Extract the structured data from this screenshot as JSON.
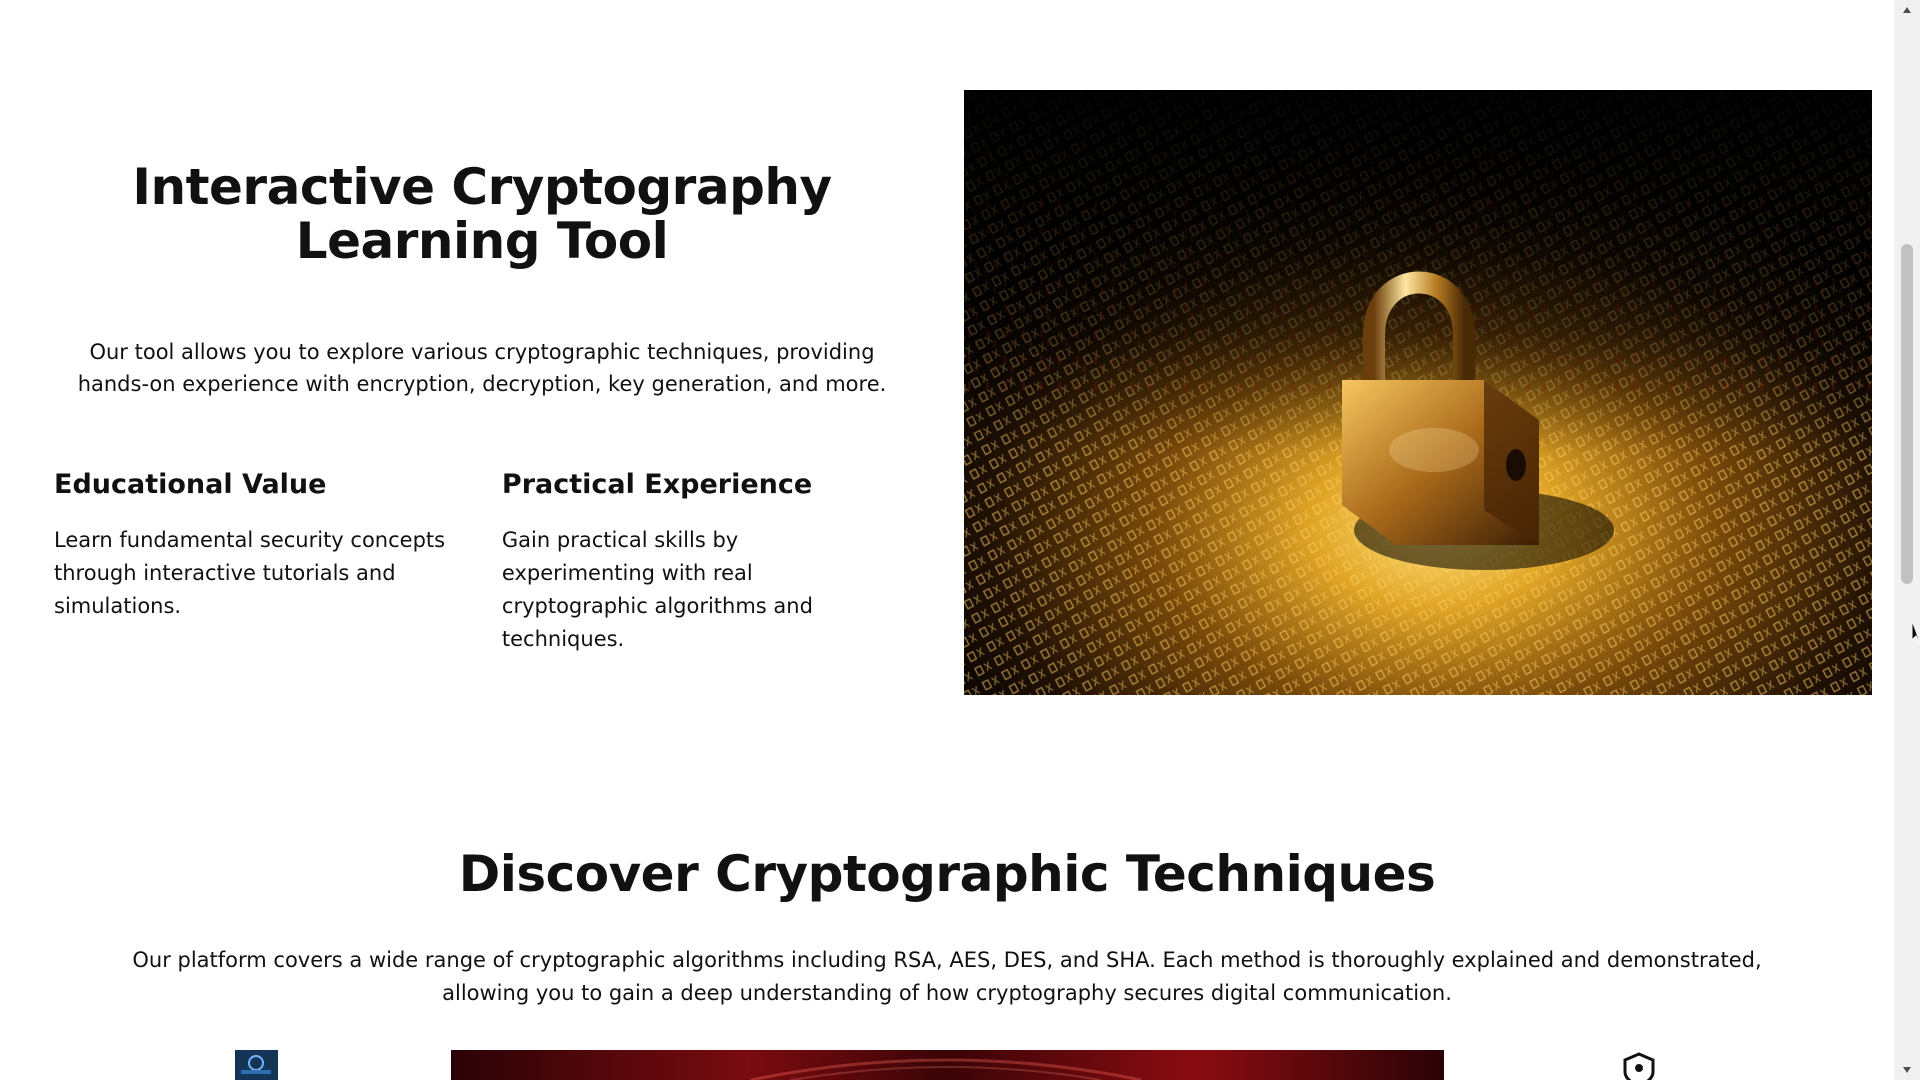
{
  "hero": {
    "title": "Interactive Cryptography Learning Tool",
    "intro": "Our tool allows you to explore various cryptographic techniques, providing hands-on experience with encryption, decryption, key generation, and more.",
    "image_subject": "golden padlock on glowing code background",
    "features": [
      {
        "heading": "Educational Value",
        "text": "Learn fundamental security concepts through interactive tutorials and simulations."
      },
      {
        "heading": "Practical Experience",
        "text": "Gain practical skills by experimenting with real cryptographic algorithms and techniques."
      }
    ]
  },
  "discover": {
    "title": "Discover Cryptographic Techniques",
    "text": "Our platform covers a wide range of cryptographic algorithms including RSA, AES, DES, and SHA. Each method is thoroughly explained and demonstrated, allowing you to gain a deep understanding of how cryptography secures digital communication."
  },
  "icons": {
    "thumb_small": "app-thumbnail-icon",
    "banner": "red-security-banner",
    "right": "shield-icon"
  },
  "colors": {
    "text": "#111111",
    "background": "#ffffff",
    "image_gold": "#d99a1e",
    "banner_red": "#7a0b10"
  }
}
